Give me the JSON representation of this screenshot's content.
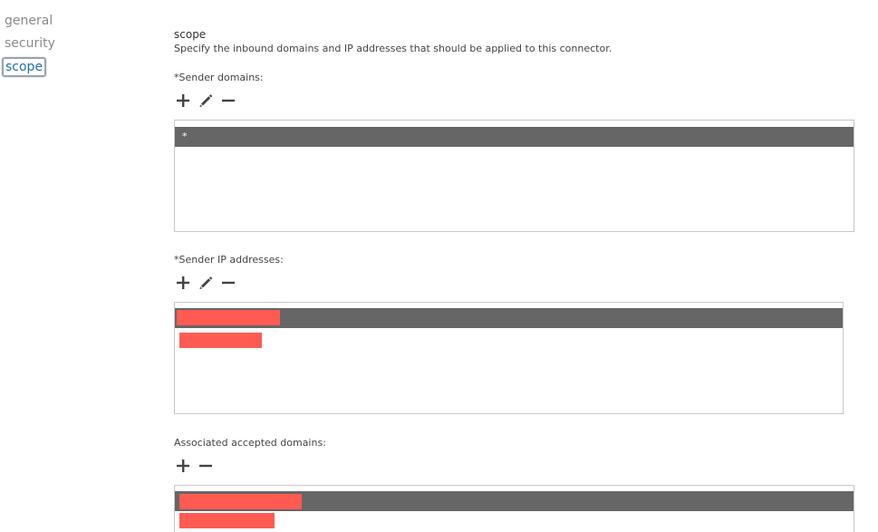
{
  "nav": {
    "items": [
      {
        "label": "general",
        "selected": false
      },
      {
        "label": "security",
        "selected": false
      },
      {
        "label": "scope",
        "selected": true
      }
    ]
  },
  "scope": {
    "title": "scope",
    "description": "Specify the inbound domains and IP addresses that should be applied to this connector."
  },
  "sender_domains": {
    "label": "*Sender domains:",
    "rows": [
      "*"
    ]
  },
  "sender_ips": {
    "label": "*Sender IP addresses:",
    "rows": [
      "",
      ""
    ]
  },
  "accepted_domains": {
    "label": "Associated accepted domains:",
    "rows": [
      "",
      ""
    ]
  },
  "colors": {
    "selected_row": "#666666",
    "redaction": "#ff5b52",
    "nav_selected": "#1e6faa"
  }
}
